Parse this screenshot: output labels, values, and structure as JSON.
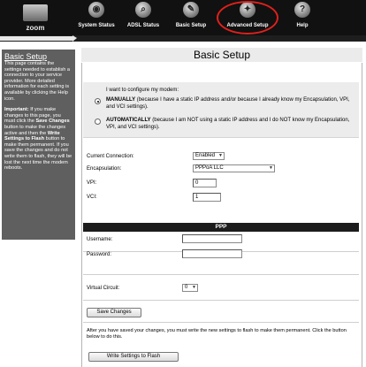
{
  "brand": {
    "logo_text": "zoom"
  },
  "nav": {
    "items": [
      {
        "label": "System Status",
        "icon": "system-status-icon",
        "glyph": "◉"
      },
      {
        "label": "ADSL Status",
        "icon": "adsl-status-icon",
        "glyph": "⌕"
      },
      {
        "label": "Basic Setup",
        "icon": "basic-setup-icon",
        "glyph": "✎"
      },
      {
        "label": "Advanced Setup",
        "icon": "advanced-setup-icon",
        "glyph": "✦"
      },
      {
        "label": "Help",
        "icon": "help-icon",
        "glyph": "?"
      }
    ],
    "highlight_color": "#e0201c"
  },
  "sidebar": {
    "title": "Basic Setup",
    "intro": "This page contains the settings needed to establish a connection to your service provider. More detailed information for each setting is available by clicking the Help icon.",
    "important_label": "Important:",
    "important_text_1": "If you make changes to this page, you must click the",
    "save_changes_label": "Save Changes",
    "important_text_2": "button to make the changes active and then the",
    "write_label": "Write Settings to Flash",
    "important_text_3": "button to make them permanent. If you save the changes and do not write them to flash, they will be lost the next time the modem reboots."
  },
  "main": {
    "title": "Basic Setup",
    "config_prompt": "I want to configure my modem:",
    "manual": {
      "label": "MANUALLY",
      "text": "(because I have a static IP address and/or because I already know my Encapsulation, VPI, and VCI settings).",
      "selected": true
    },
    "auto": {
      "label": "AUTOMATICALLY",
      "text": "(because I am NOT using a static IP address and I do NOT know my Encapsulation, VPI, and VCI settings).",
      "selected": false
    },
    "current_connection": {
      "label": "Current Connection:",
      "value": "Enabled"
    },
    "encapsulation": {
      "label": "Encapsulation:",
      "value": "PPPoA LLC"
    },
    "vpi": {
      "label": "VPI:",
      "value": "0"
    },
    "vci": {
      "label": "VCI:",
      "value": "1"
    },
    "ppp": {
      "header": "PPP",
      "username_label": "Username:",
      "username_value": "",
      "password_label": "Password:",
      "password_value": ""
    },
    "virtual_circuit": {
      "label": "Virtual Circuit:",
      "value": "0"
    },
    "save_button": "Save Changes",
    "flash_note": "After you have saved your changes, you must write the new settings to flash to make them permanent. Click the button below to do this.",
    "flash_button": "Write Settings to Flash"
  }
}
